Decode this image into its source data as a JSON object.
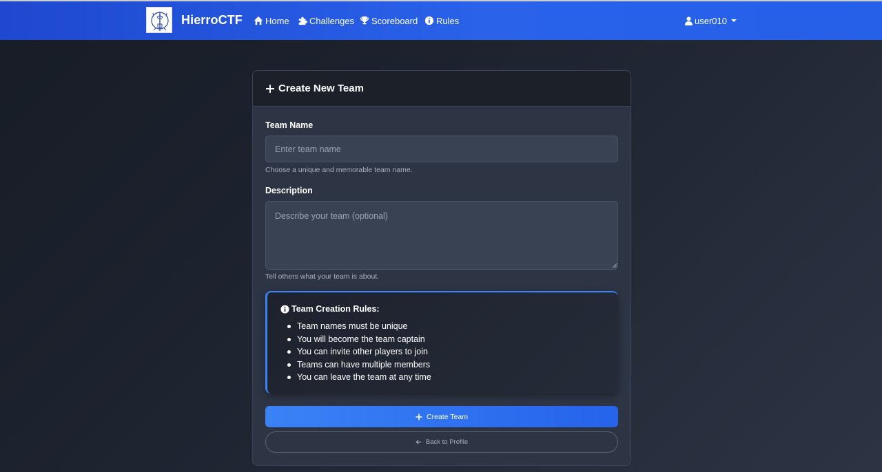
{
  "navbar": {
    "brand": "HierroCTF",
    "links": [
      {
        "label": "Home",
        "icon": "home-icon"
      },
      {
        "label": "Challenges",
        "icon": "puzzle-icon"
      },
      {
        "label": "Scoreboard",
        "icon": "trophy-icon"
      },
      {
        "label": "Rules",
        "icon": "info-circle-icon"
      }
    ],
    "user": {
      "label": "user010",
      "icon": "user-icon"
    }
  },
  "form": {
    "title": "Create New Team",
    "team_name": {
      "label": "Team Name",
      "value": "",
      "placeholder": "Enter team name",
      "help": "Choose a unique and memorable team name."
    },
    "description": {
      "label": "Description",
      "value": "",
      "placeholder": "Describe your team (optional)",
      "help": "Tell others what your team is about."
    },
    "rules": {
      "title": "Team Creation Rules:",
      "items": [
        "Team names must be unique",
        "You will become the team captain",
        "You can invite other players to join",
        "Teams can have multiple members",
        "You can leave the team at any time"
      ]
    },
    "submit_label": "Create Team",
    "back_label": "Back to Profile"
  },
  "colors": {
    "navbar": "#2563eb",
    "accent": "#3b82f6",
    "card_bg": "#2d3545",
    "page_bg": "#1e2430"
  }
}
